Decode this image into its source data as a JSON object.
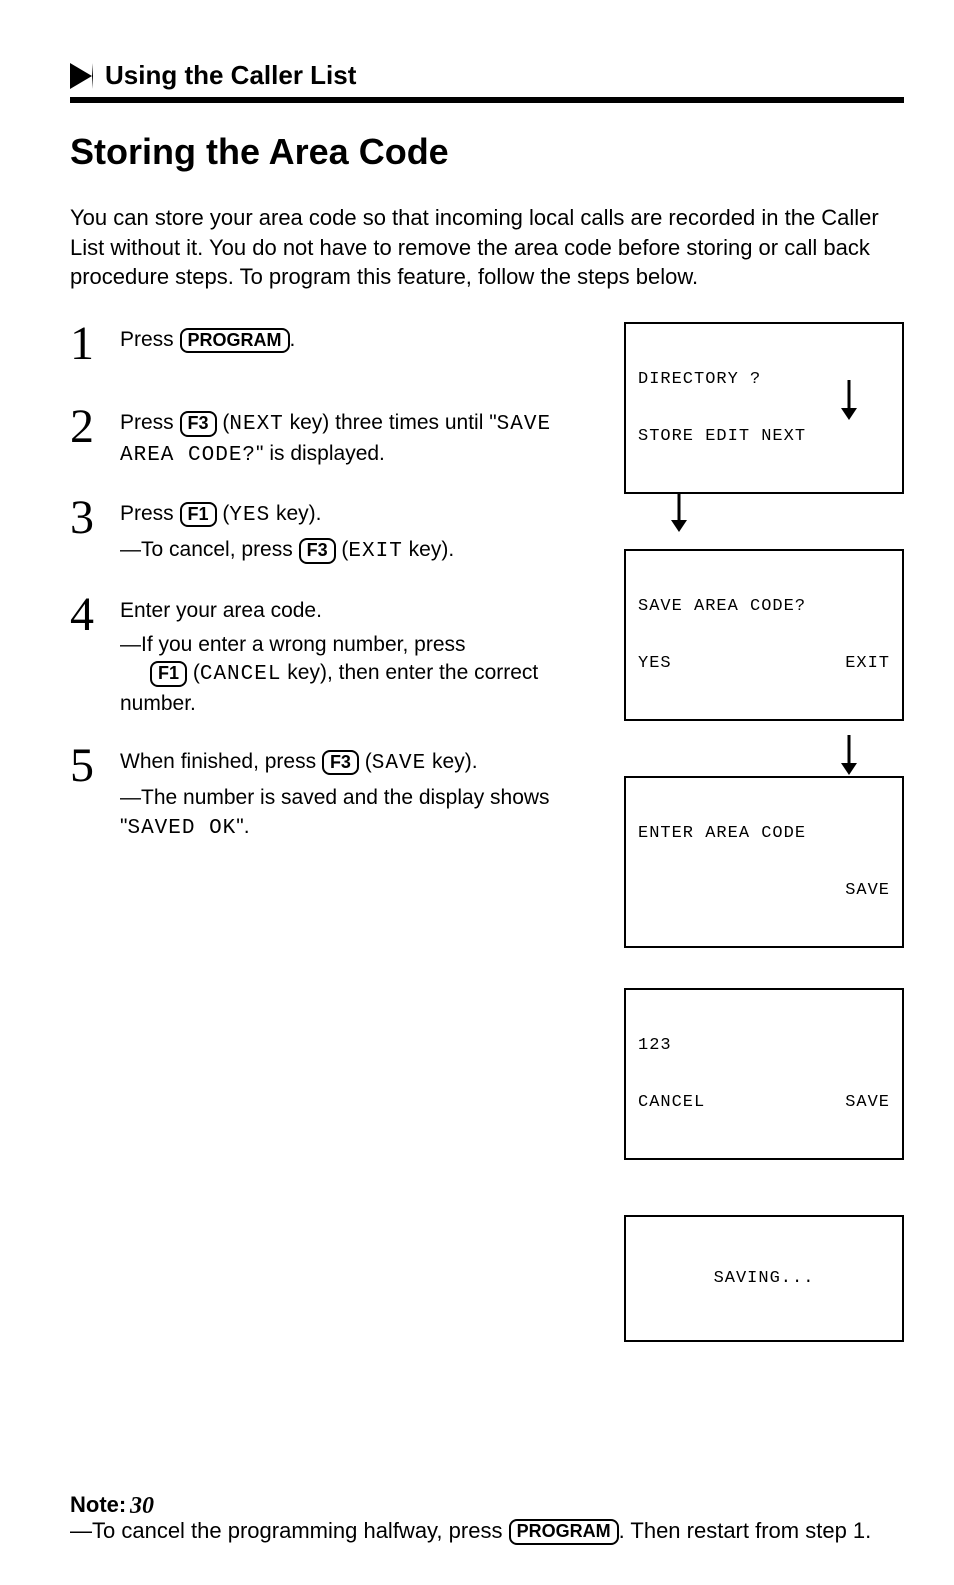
{
  "section_header": "Using the Caller List",
  "title": "Storing the Area Code",
  "intro": "You can store your area code so that incoming local calls are recorded in the Caller List without it. You do not have to remove the area code before storing or call back procedure steps. To program this feature, follow the steps below.",
  "steps": {
    "s1": {
      "num": "1",
      "t1": "Press ",
      "k1": "PROGRAM",
      "t2": "."
    },
    "s2": {
      "num": "2",
      "t1": "Press ",
      "k1": "F3",
      "t2": " (",
      "mono1": "NEXT",
      "t3": " key) three times until \"",
      "mono2": "SAVE AREA CODE?",
      "t4": "\" is displayed."
    },
    "s3": {
      "num": "3",
      "t1": "Press ",
      "k1": "F1",
      "t2": " (",
      "mono1": "YES",
      "t3": " key).",
      "sub1": "—To cancel, press ",
      "k2": "F3",
      "sub2": " (",
      "mono2": "EXIT",
      "sub3": " key)."
    },
    "s4": {
      "num": "4",
      "t1": "Enter your area code.",
      "sub1": "—If you enter a wrong number, press ",
      "k1": "F1",
      "sub2": " (",
      "mono1": "CANCEL",
      "sub3": " key), then enter the correct number."
    },
    "s5": {
      "num": "5",
      "t1": "When finished, press ",
      "k1": "F3",
      "t2": " (",
      "mono1": "SAVE",
      "t3": " key).",
      "sub1": "—The number is saved and the display shows \"",
      "mono2": "SAVED OK",
      "sub2": "\"."
    }
  },
  "screens": {
    "sc1": {
      "l1": "DIRECTORY ?",
      "l2": "STORE EDIT NEXT"
    },
    "sc2": {
      "l1": "SAVE AREA CODE?",
      "l2a": "YES",
      "l2b": "EXIT"
    },
    "sc3": {
      "l1": "ENTER AREA CODE",
      "l2b": "SAVE"
    },
    "sc4": {
      "l1": "123",
      "l2a": "CANCEL",
      "l2b": "SAVE"
    },
    "sc5": {
      "l1": "SAVING..."
    }
  },
  "note": {
    "title": "Note:",
    "t1": "—To cancel the programming halfway, press ",
    "k1": "PROGRAM",
    "t2": ". Then restart from step 1."
  },
  "page_num": "30"
}
